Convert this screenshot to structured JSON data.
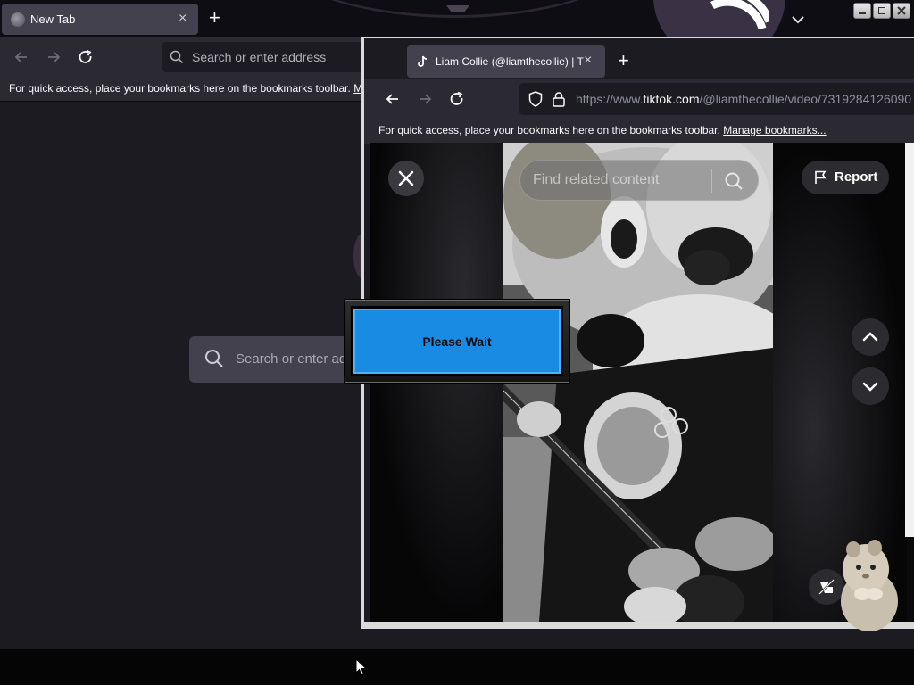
{
  "background_window": {
    "tab": {
      "title": "New Tab",
      "close": "×"
    },
    "new_tab_symbol": "+",
    "address_placeholder": "Search or enter address",
    "bookmarks_bar": {
      "text": "For quick access, place your bookmarks here on the bookmarks toolbar.",
      "link": "Ma"
    },
    "content_search_placeholder": "Search or enter ad"
  },
  "foreground_window": {
    "tab": {
      "title": "Liam Collie (@liamthecollie) | T",
      "close": "×"
    },
    "new_tab_symbol": "+",
    "url": {
      "prefix": "https://www.",
      "host": "tiktok.com",
      "path": "/@liamthecollie/video/7319284126090"
    },
    "bookmarks_bar": {
      "text": "For quick access, place your bookmarks here on the bookmarks toolbar.",
      "link": "Manage bookmarks..."
    },
    "tiktok": {
      "search_placeholder": "Find related content",
      "report_label": "Report"
    }
  },
  "dialog": {
    "label": "Please Wait"
  },
  "icons": [
    "back-arrow-icon",
    "forward-arrow-icon",
    "reload-icon",
    "search-icon",
    "shield-icon",
    "lock-icon",
    "tiktok-icon",
    "close-icon",
    "flag-icon",
    "chevron-up-icon",
    "chevron-down-icon",
    "mini-player-icon",
    "firefox-icon",
    "mouse-cursor-icon"
  ],
  "colors": {
    "dialog_blue": "#1a8be3",
    "browser_dark": "#1c1b22",
    "toolbar": "#2b2a33",
    "tab": "#42414d"
  }
}
